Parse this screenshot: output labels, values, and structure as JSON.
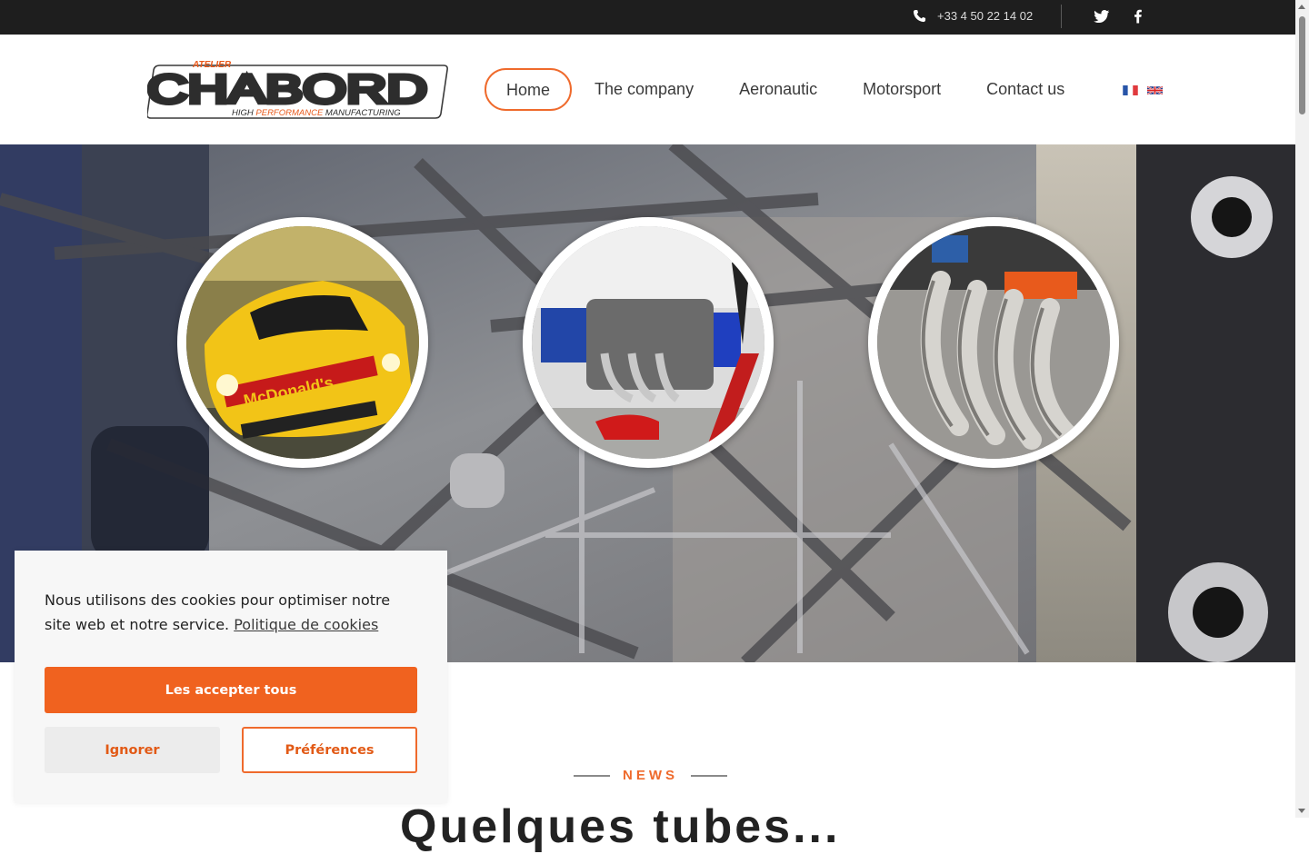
{
  "topbar": {
    "phone": "+33 4 50 22 14 02",
    "icons": [
      "phone-icon",
      "twitter-icon",
      "facebook-icon"
    ]
  },
  "logo": {
    "top_text": "ATELIER",
    "main_text": "CHABORD",
    "tagline_parts": [
      "HIGH ",
      "PERFORMANCE",
      " MANUFACTURING"
    ]
  },
  "nav": {
    "items": [
      {
        "label": "Home",
        "active": true
      },
      {
        "label": "The company",
        "active": false
      },
      {
        "label": "Aeronautic",
        "active": false
      },
      {
        "label": "Motorsport",
        "active": false
      },
      {
        "label": "Contact us",
        "active": false
      }
    ],
    "flags": [
      "flag-fr-icon",
      "flag-gb-icon"
    ]
  },
  "hero": {
    "images": [
      "race-car-photo",
      "aircraft-engine-photo",
      "exhaust-manifold-photo"
    ]
  },
  "news": {
    "kicker": "NEWS",
    "title": "Quelques tubes..."
  },
  "cookie": {
    "message": "Nous utilisons des cookies pour optimiser notre site web et notre service.",
    "policy_link": "Politique de cookies",
    "accept": "Les accepter tous",
    "ignore": "Ignorer",
    "preferences": "Préférences"
  },
  "colors": {
    "accent": "#ef6a2c",
    "topbar_bg": "#1e1e1e"
  }
}
